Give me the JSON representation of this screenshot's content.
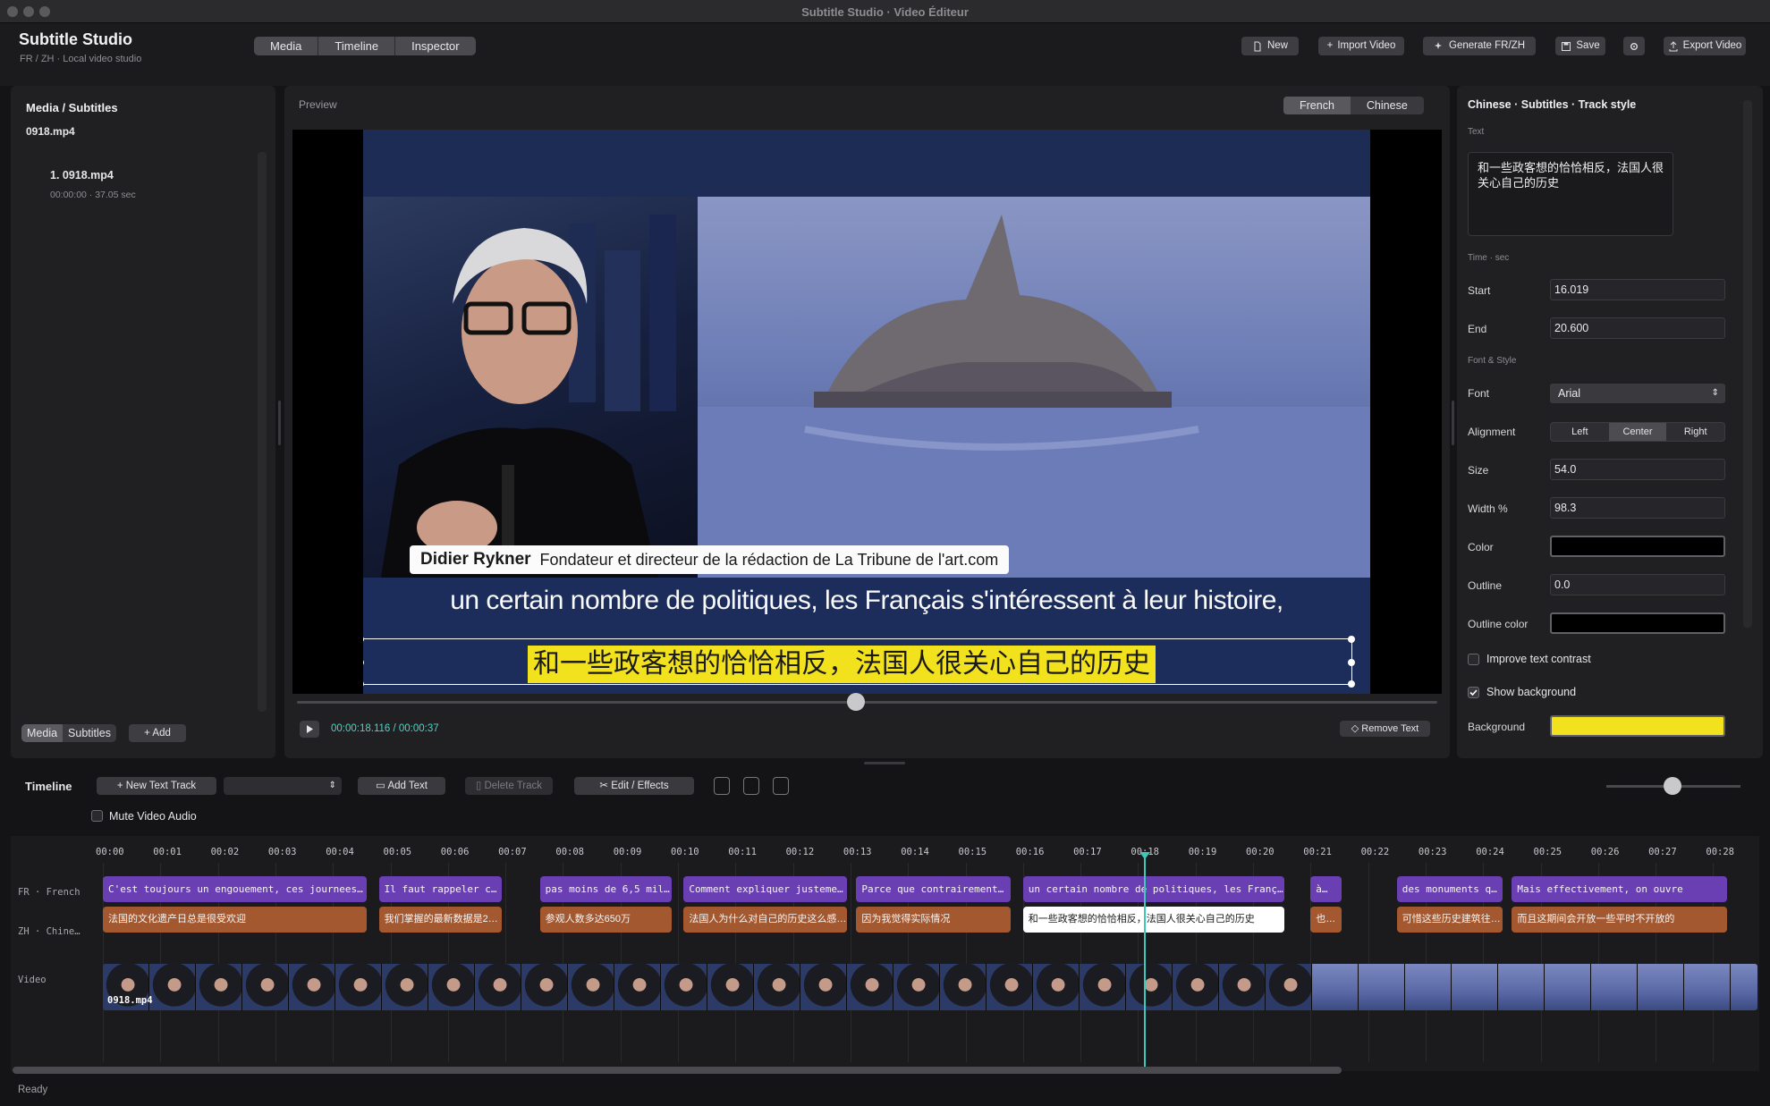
{
  "window": {
    "title": "Subtitle Studio · Video Éditeur"
  },
  "header": {
    "app_name": "Subtitle Studio",
    "app_subtitle": "FR / ZH · Local video studio",
    "tabs": [
      "Media",
      "Timeline",
      "Inspector"
    ],
    "buttons": {
      "new": "New",
      "import": "Import Video",
      "generate": "Generate FR/ZH",
      "save": "Save",
      "export": "Export Video"
    }
  },
  "left_panel": {
    "title": "Media / Subtitles",
    "current_file": "0918.mp4",
    "items": [
      {
        "label": "1. 0918.mp4",
        "meta": "00:00:00 · 37.05 sec"
      }
    ],
    "bottom_tabs": [
      "Media",
      "Subtitles"
    ],
    "add_label": "Add"
  },
  "preview": {
    "title": "Preview",
    "lang_tabs": [
      "French",
      "Chinese"
    ],
    "name_plate": {
      "name": "Didier Rykner",
      "role": "Fondateur et directeur de la rédaction de La Tribune de l'art.com"
    },
    "subtitle_fr": "un certain nombre de politiques, les Français s'intéressent à leur histoire,",
    "subtitle_zh": "和一些政客想的恰恰相反，法国人很关心自己的历史",
    "timecode": "00:00:18.116 / 00:00:37",
    "scrub_progress": 0.49,
    "remove_label": "Remove Text"
  },
  "inspector": {
    "title": "Chinese · Subtitles · Track style",
    "text_label": "Text",
    "text_value": "和一些政客想的恰恰相反，法国人很关心自己的历史",
    "time_section": "Time · sec",
    "start_label": "Start",
    "start_value": "16.019",
    "end_label": "End",
    "end_value": "20.600",
    "font_section": "Font & Style",
    "font_label": "Font",
    "font_value": "Arial",
    "alignment_label": "Alignment",
    "alignment_options": [
      "Left",
      "Center",
      "Right"
    ],
    "size_label": "Size",
    "size_value": "54.0",
    "width_label": "Width %",
    "width_value": "98.3",
    "color_label": "Color",
    "color_value": "#000000",
    "outline_label": "Outline",
    "outline_value": "0.0",
    "outline_color_label": "Outline color",
    "outline_color_value": "#000000",
    "contrast_label": "Improve text contrast",
    "show_bg_label": "Show background",
    "bg_label": "Background",
    "bg_value": "#f2e21d"
  },
  "timeline": {
    "title": "Timeline",
    "new_track": "New Text Track",
    "add_text": "Add Text",
    "delete_track": "Delete Track",
    "edit_effects": "Edit / Effects",
    "mute_label": "Mute Video Audio",
    "ruler": [
      "00:00",
      "00:01",
      "00:02",
      "00:03",
      "00:04",
      "00:05",
      "00:06",
      "00:07",
      "00:08",
      "00:09",
      "00:10",
      "00:11",
      "00:12",
      "00:13",
      "00:14",
      "00:15",
      "00:16",
      "00:17",
      "00:18",
      "00:19",
      "00:20",
      "00:21",
      "00:22",
      "00:23",
      "00:24",
      "00:25",
      "00:26",
      "00:27",
      "00:28"
    ],
    "tracks": {
      "fr": "FR · French",
      "zh": "ZH · Chine…",
      "video": "Video"
    },
    "fr_clips": [
      {
        "text": "C'est toujours un engouement, ces journees…",
        "start": 0.0,
        "end": 4.65
      },
      {
        "text": "Il faut rappeler c…",
        "start": 4.8,
        "end": 7.0
      },
      {
        "text": "pas moins de 6,5 milli…",
        "start": 7.6,
        "end": 9.95
      },
      {
        "text": "Comment expliquer justemen…",
        "start": 10.1,
        "end": 13.0
      },
      {
        "text": "Parce que contrairement…",
        "start": 13.1,
        "end": 15.85
      },
      {
        "text": "un certain nombre de politiques, les Franç…",
        "start": 16.0,
        "end": 20.6
      },
      {
        "text": "à…",
        "start": 21.0,
        "end": 21.6
      },
      {
        "text": "des monuments qui sont…",
        "start": 22.5,
        "end": 24.4
      },
      {
        "text": "Mais effectivement, on ouvre",
        "start": 24.5,
        "end": 28.3
      }
    ],
    "zh_clips": [
      {
        "text": "法国的文化遗产日总是很受欢迎",
        "start": 0.0,
        "end": 4.65,
        "selected": false
      },
      {
        "text": "我们掌握的最新数据是2…",
        "start": 4.8,
        "end": 7.0,
        "selected": false
      },
      {
        "text": "参观人数多达650万",
        "start": 7.6,
        "end": 9.95,
        "selected": false
      },
      {
        "text": "法国人为什么对自己的历史这么感…",
        "start": 10.1,
        "end": 13.0,
        "selected": false
      },
      {
        "text": "因为我觉得实际情况",
        "start": 13.1,
        "end": 15.85,
        "selected": false
      },
      {
        "text": "和一些政客想的恰恰相反，法国人很关心自己的历史",
        "start": 16.0,
        "end": 20.6,
        "selected": true
      },
      {
        "text": "也…",
        "start": 21.0,
        "end": 21.6,
        "selected": false
      },
      {
        "text": "可惜这些历史建筑往往没有得…",
        "start": 22.5,
        "end": 24.4,
        "selected": false
      },
      {
        "text": "而且这期间会开放一些平时不开放的",
        "start": 24.5,
        "end": 28.3,
        "selected": false
      }
    ],
    "video_clip_label": "0918.mp4",
    "playhead_time": 18.116
  },
  "status": "Ready"
}
